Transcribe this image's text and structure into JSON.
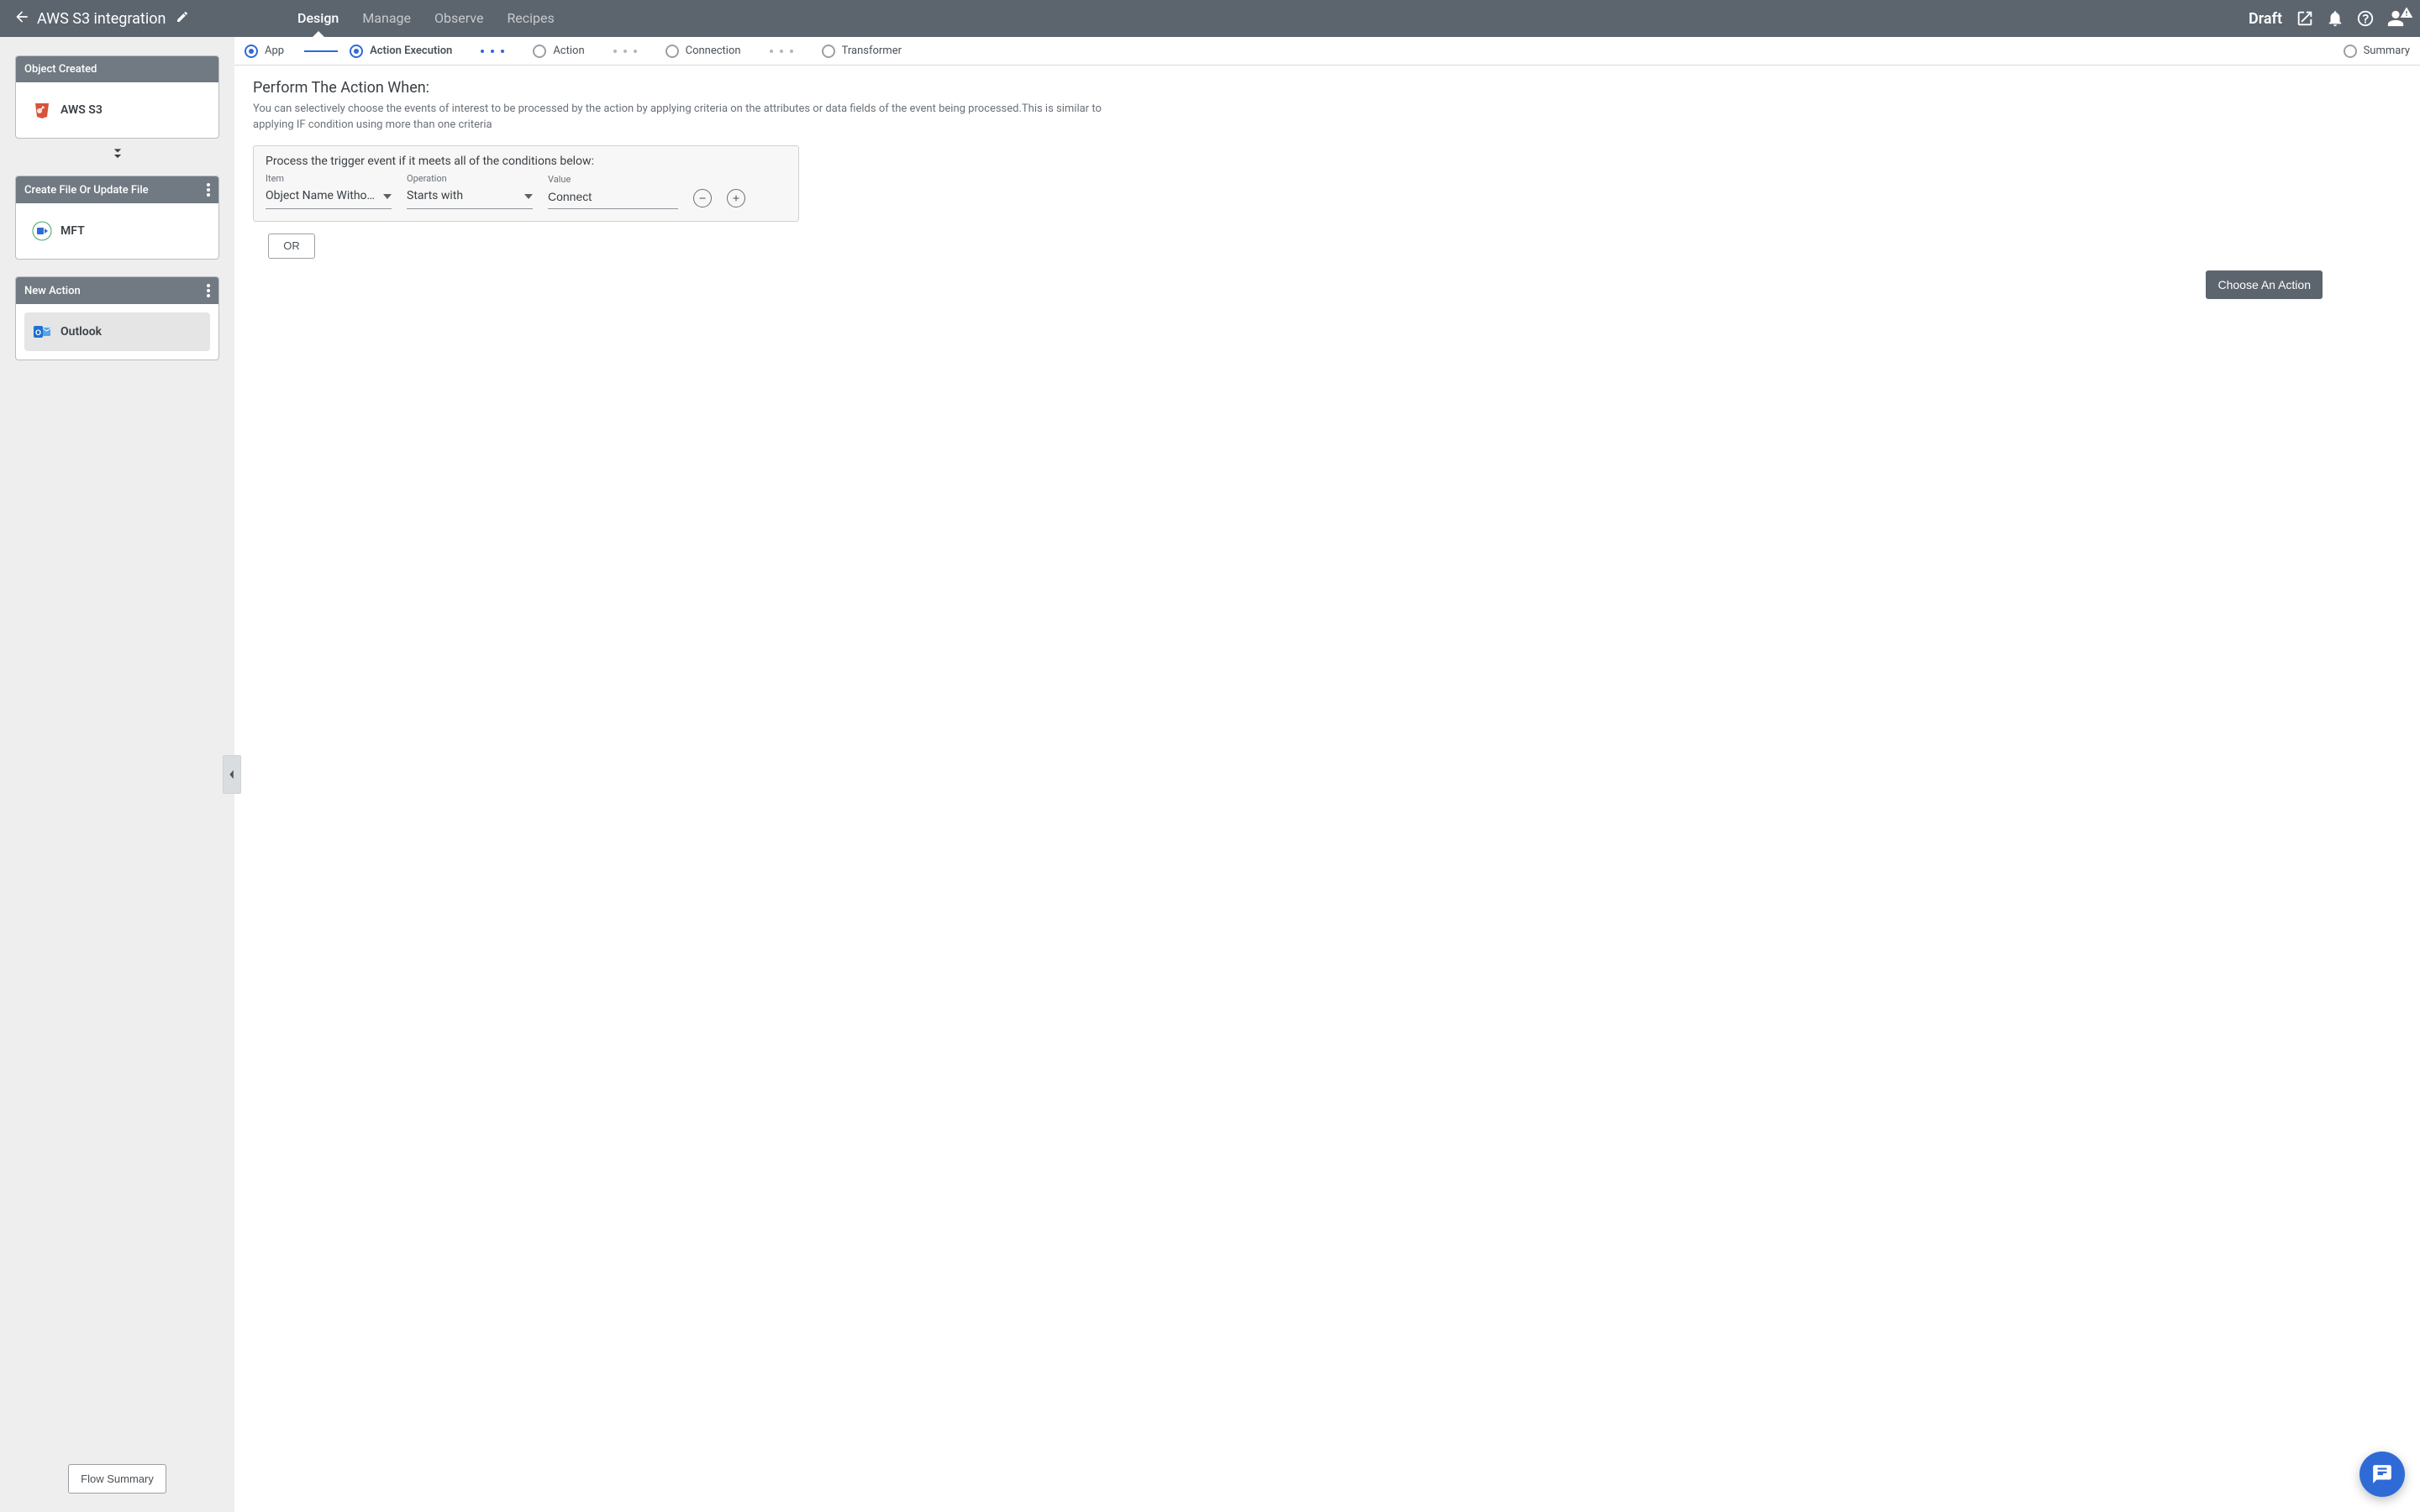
{
  "header": {
    "title": "AWS S3 integration",
    "status": "Draft",
    "nav": [
      {
        "label": "Design",
        "active": true
      },
      {
        "label": "Manage",
        "active": false
      },
      {
        "label": "Observe",
        "active": false
      },
      {
        "label": "Recipes",
        "active": false
      }
    ]
  },
  "sidebar": {
    "cards": [
      {
        "title": "Object Created",
        "app": "AWS S3",
        "icon": "aws-s3",
        "menu": false,
        "selected": false
      },
      {
        "title": "Create File Or Update File",
        "app": "MFT",
        "icon": "mft",
        "menu": true,
        "selected": false
      },
      {
        "title": "New Action",
        "app": "Outlook",
        "icon": "outlook",
        "menu": true,
        "selected": true
      }
    ],
    "flow_summary_label": "Flow Summary"
  },
  "stepper": {
    "steps": [
      {
        "label": "App",
        "state": "on",
        "active": false
      },
      {
        "label": "Action Execution",
        "state": "on",
        "active": true
      },
      {
        "label": "Action",
        "state": "off",
        "active": false
      },
      {
        "label": "Connection",
        "state": "off",
        "active": false
      },
      {
        "label": "Transformer",
        "state": "off",
        "active": false
      },
      {
        "label": "Summary",
        "state": "off",
        "active": false
      }
    ]
  },
  "content": {
    "heading": "Perform The Action When:",
    "description": "You can selectively choose the events of interest to be processed by the action by applying criteria on the attributes or data fields of the event being processed.This is similar to applying IF condition using more than one criteria",
    "cond_title": "Process the trigger event if it meets all of the conditions below:",
    "labels": {
      "item": "Item",
      "operation": "Operation",
      "value": "Value"
    },
    "row": {
      "item": "Object Name Without …",
      "operation": "Starts with",
      "value": "Connect"
    },
    "or_label": "OR",
    "choose_action_label": "Choose An Action"
  }
}
